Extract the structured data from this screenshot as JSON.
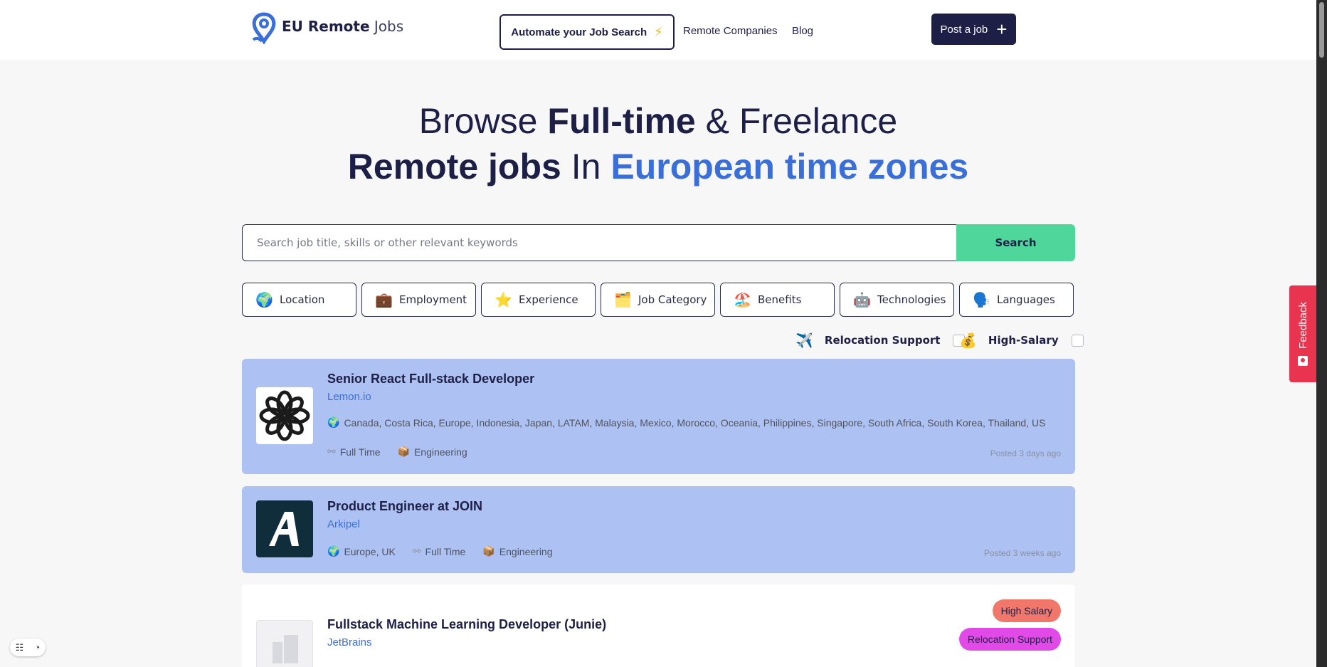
{
  "header": {
    "logo_bold": "EU Remote",
    "logo_light": "Jobs",
    "automate_label": "Automate your Job Search",
    "nav": [
      "Remote Companies",
      "Blog"
    ],
    "post_job_label": "Post a job"
  },
  "hero": {
    "w1": "Browse",
    "w2": "Full-time",
    "w3": "& Freelance",
    "w4": "Remote jobs",
    "w5": "In",
    "w6": "European time zones"
  },
  "search": {
    "placeholder": "Search job title, skills or other relevant keywords",
    "button_label": "Search"
  },
  "filters": [
    {
      "icon": "🌍",
      "label": "Location"
    },
    {
      "icon": "💼",
      "label": "Employment"
    },
    {
      "icon": "⭐",
      "label": "Experience"
    },
    {
      "icon": "🗂️",
      "label": "Job Category"
    },
    {
      "icon": "🏖️",
      "label": "Benefits"
    },
    {
      "icon": "🤖",
      "label": "Technologies"
    },
    {
      "icon": "🗣️",
      "label": "Languages"
    }
  ],
  "toggles": {
    "relocation": {
      "icon": "✈️",
      "label": "Relocation Support"
    },
    "salary": {
      "icon": "💰",
      "label": "High-Salary"
    }
  },
  "jobs": [
    {
      "title": "Senior React Full-stack Developer",
      "company": "Lemon.io",
      "locations": "Canada, Costa Rica, Europe, Indonesia, Japan, LATAM, Malaysia, Mexico, Morocco, Oceania, Philippines, Singapore, South Africa, South Korea, Thailand, US",
      "employment": "Full Time",
      "category": "Engineering",
      "posted": "Posted 3 days ago"
    },
    {
      "title": "Product Engineer at JOIN",
      "company": "Arkipel",
      "locations": "Europe, UK",
      "employment": "Full Time",
      "category": "Engineering",
      "posted": "Posted 3 weeks ago"
    },
    {
      "title": "Fullstack Machine Learning Developer (Junie)",
      "company": "JetBrains",
      "badges": [
        "High Salary",
        "Relocation Support"
      ]
    }
  ],
  "feedback_label": "Feedback",
  "colors": {
    "navy": "#1e1f47",
    "blue": "#3a6ed8",
    "featured_bg": "#adc2f2",
    "search_green": "#4fd69b",
    "feedback_red": "#e8344f",
    "badge_salary": "#f0776a",
    "badge_relocation": "#e24ae8"
  }
}
